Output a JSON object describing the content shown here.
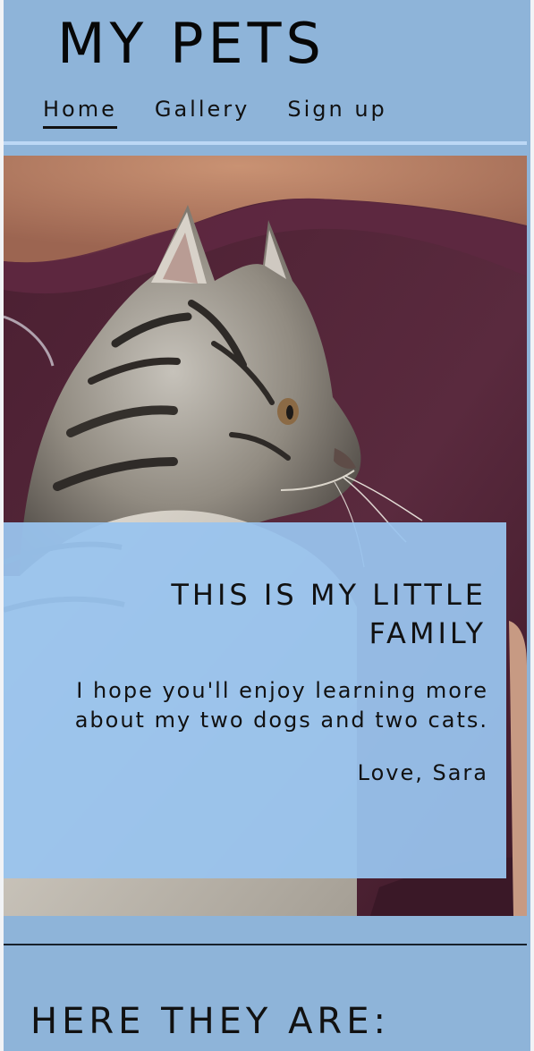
{
  "site": {
    "title": "MY PETS"
  },
  "nav": {
    "items": [
      {
        "label": "Home",
        "active": true
      },
      {
        "label": "Gallery",
        "active": false
      },
      {
        "label": "Sign up",
        "active": false
      }
    ]
  },
  "hero": {
    "image_subject": "kitten-held-by-person"
  },
  "intro": {
    "title": "THIS IS MY LITTLE FAMILY",
    "text": "I hope you'll enjoy learning more about my two dogs and two cats.",
    "signature": "Love, Sara"
  },
  "section": {
    "title": "HERE THEY ARE:"
  },
  "colors": {
    "header_bg": "#8eb4d9",
    "accent_line": "#bcd8f5",
    "card_bg": "#99c4ee",
    "text": "#111111"
  }
}
